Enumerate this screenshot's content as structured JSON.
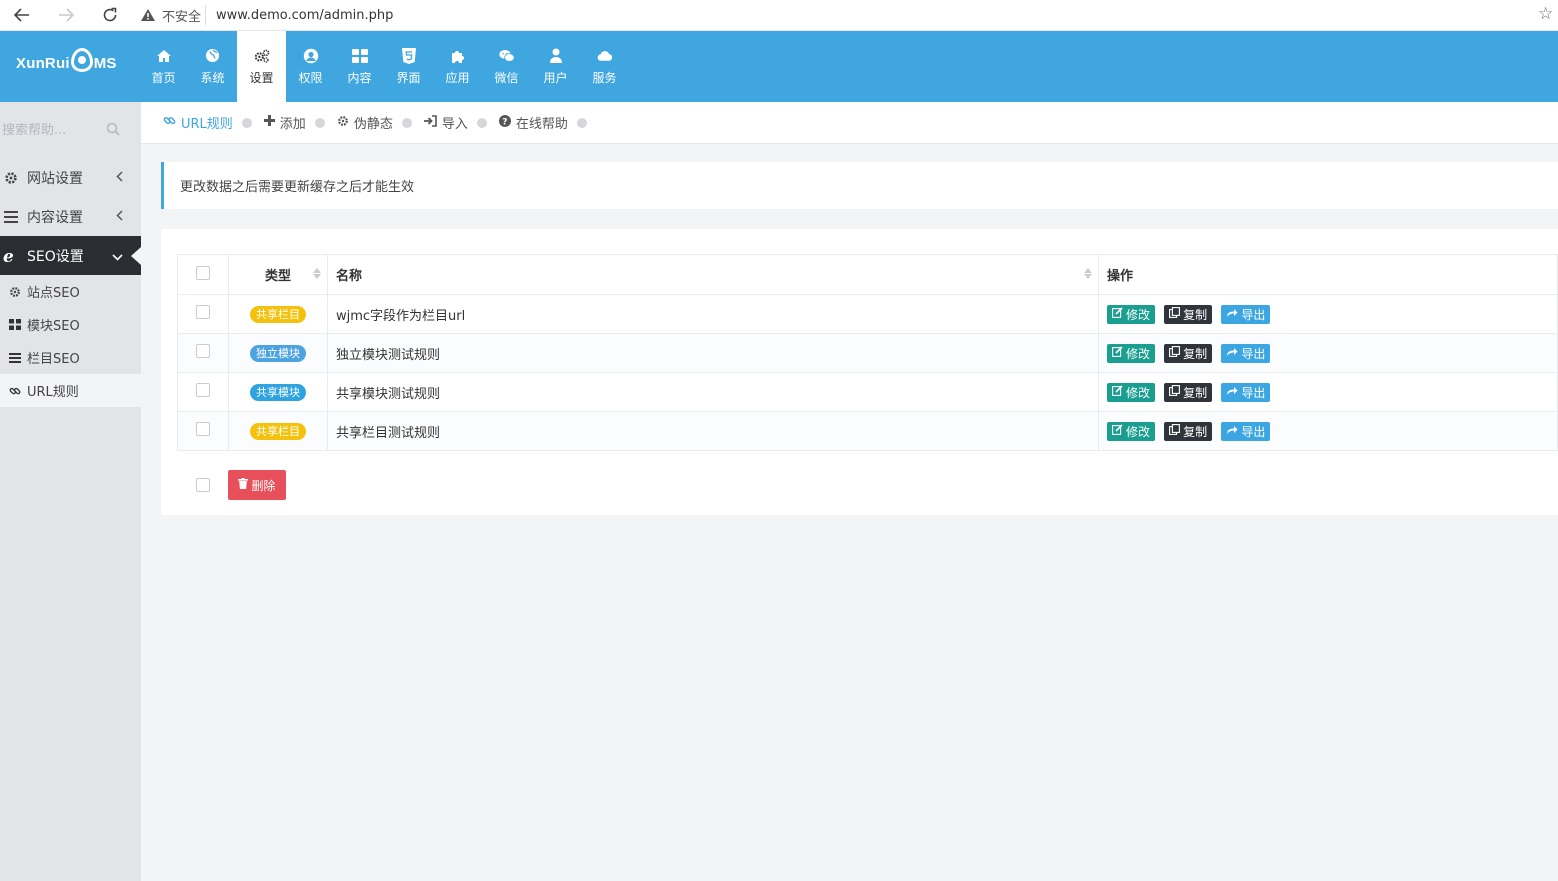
{
  "browser": {
    "security_label": "不安全",
    "url": "www.demo.com/admin.php"
  },
  "logo": {
    "text_left": "XunRui",
    "text_right": "MS"
  },
  "topnav": [
    {
      "label": "首页",
      "icon": "home-icon"
    },
    {
      "label": "系统",
      "icon": "globe-icon"
    },
    {
      "label": "设置",
      "icon": "cogs-icon",
      "active": true
    },
    {
      "label": "权限",
      "icon": "user-circle-icon"
    },
    {
      "label": "内容",
      "icon": "grid-icon"
    },
    {
      "label": "界面",
      "icon": "html5-icon"
    },
    {
      "label": "应用",
      "icon": "puzzle-icon"
    },
    {
      "label": "微信",
      "icon": "wechat-icon"
    },
    {
      "label": "用户",
      "icon": "user-icon"
    },
    {
      "label": "服务",
      "icon": "cloud-icon"
    }
  ],
  "sidebar": {
    "search_placeholder": "搜索帮助...",
    "groups": [
      {
        "label": "网站设置",
        "icon": "gear-icon"
      },
      {
        "label": "内容设置",
        "icon": "bars-icon"
      },
      {
        "label": "SEO设置",
        "icon": "ie-icon",
        "open": true
      }
    ],
    "sub_items": [
      {
        "label": "站点SEO",
        "icon": "gear-icon"
      },
      {
        "label": "模块SEO",
        "icon": "grid-icon"
      },
      {
        "label": "栏目SEO",
        "icon": "bars-icon"
      },
      {
        "label": "URL规则",
        "icon": "link-icon",
        "active": true
      }
    ]
  },
  "subnav": [
    {
      "label": "URL规则",
      "icon": "link-icon",
      "active": true
    },
    {
      "label": "添加",
      "icon": "plus-icon"
    },
    {
      "label": "伪静态",
      "icon": "gear-icon"
    },
    {
      "label": "导入",
      "icon": "sign-in-icon"
    },
    {
      "label": "在线帮助",
      "icon": "question-icon"
    }
  ],
  "notice": "更改数据之后需要更新缓存之后才能生效",
  "table": {
    "headers": {
      "type": "类型",
      "name": "名称",
      "actions": "操作"
    },
    "rows": [
      {
        "type": "共享栏目",
        "type_color": "yellow",
        "name": "wjmc字段作为栏目url"
      },
      {
        "type": "独立模块",
        "type_color": "blue",
        "name": "独立模块测试规则"
      },
      {
        "type": "共享模块",
        "type_color": "sky",
        "name": "共享模块测试规则"
      },
      {
        "type": "共享栏目",
        "type_color": "yellow",
        "name": "共享栏目测试规则"
      }
    ],
    "action_labels": {
      "edit": "修改",
      "copy": "复制",
      "export": "导出"
    }
  },
  "delete_label": "删除",
  "colors": {
    "header_blue": "#3fa6e0",
    "badge_yellow": "#f4c20d",
    "badge_blue": "#4da3e0",
    "edit_green": "#1a9e8f",
    "copy_dark": "#2f353b",
    "export_blue": "#3ba6e1",
    "delete_red": "#e7505a"
  }
}
